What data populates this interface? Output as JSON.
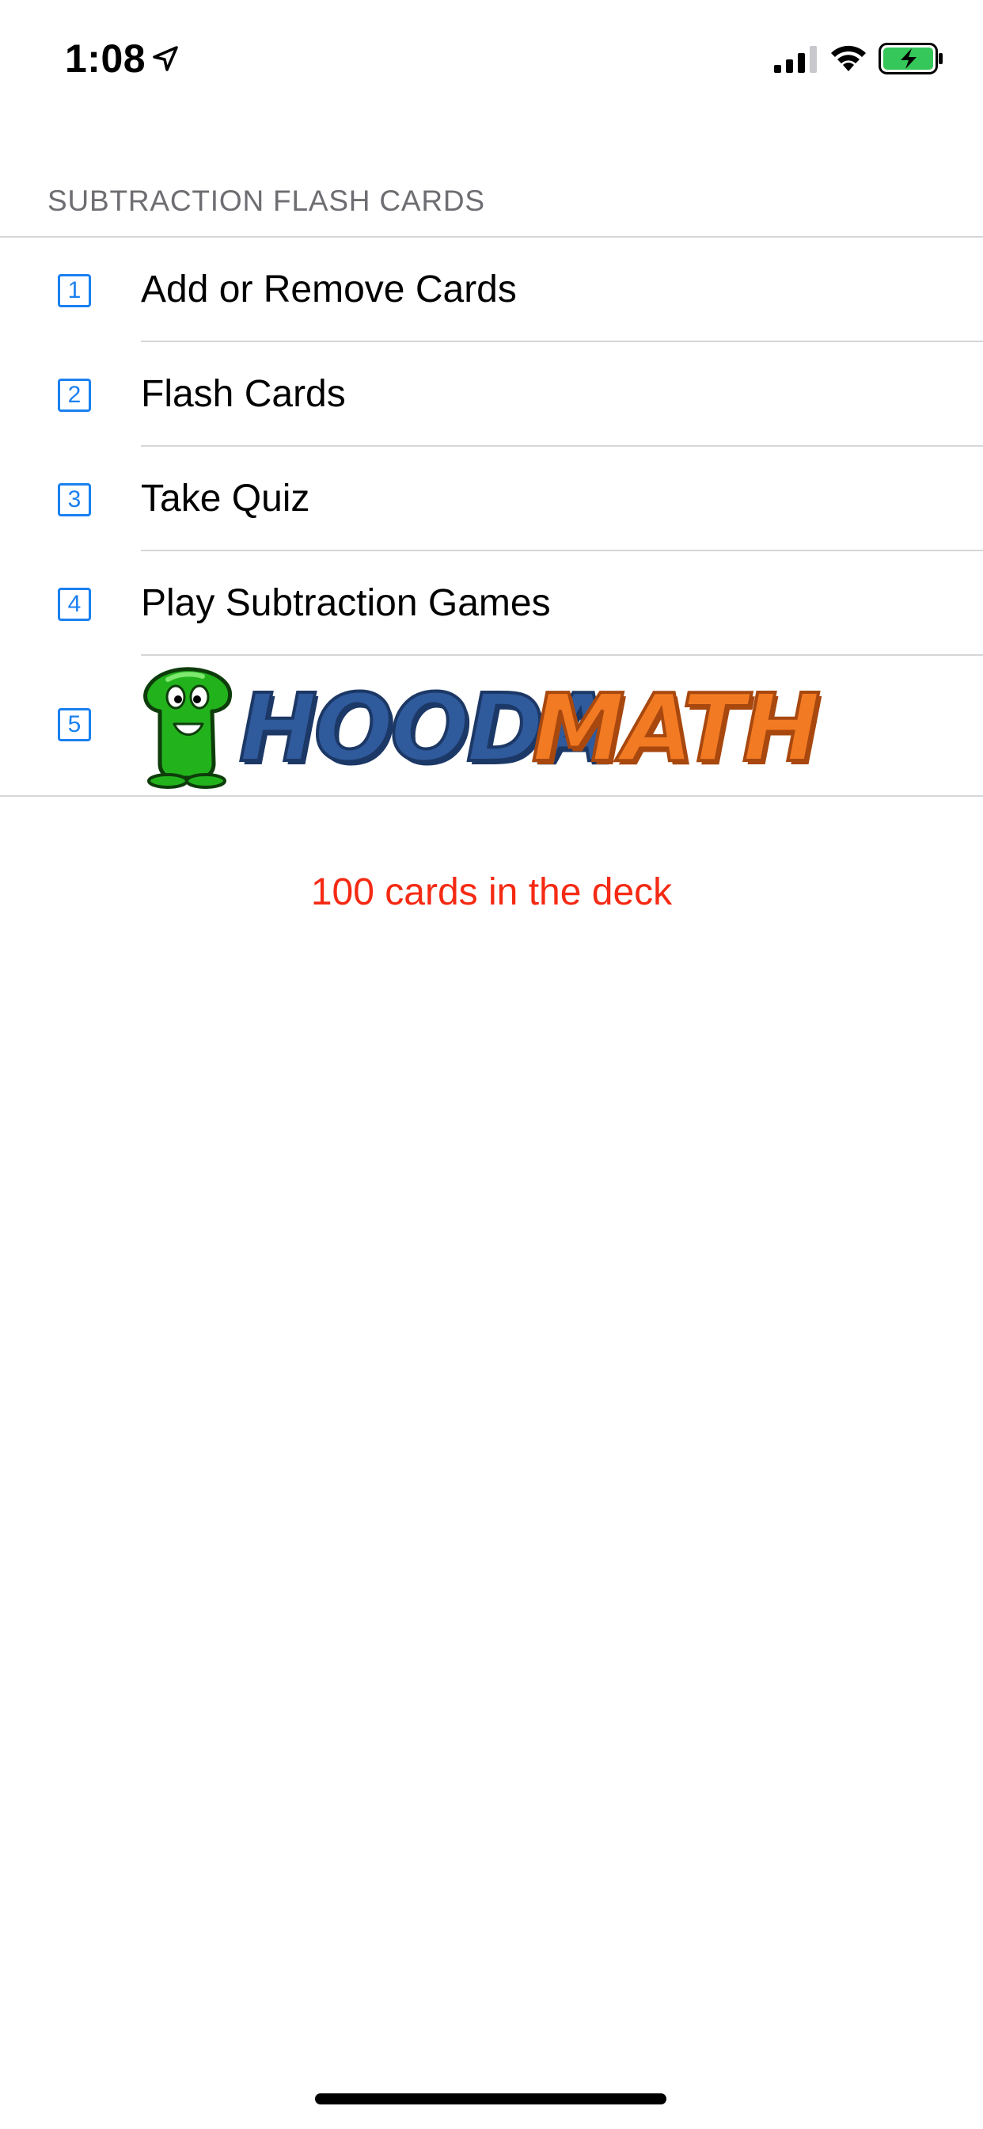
{
  "status_bar": {
    "time": "1:08"
  },
  "section": {
    "header": "SUBTRACTION FLASH CARDS"
  },
  "menu": {
    "items": [
      {
        "number": "1",
        "label": "Add or Remove Cards"
      },
      {
        "number": "2",
        "label": "Flash Cards"
      },
      {
        "number": "3",
        "label": "Take Quiz"
      },
      {
        "number": "4",
        "label": "Play Subtraction Games"
      },
      {
        "number": "5",
        "logo_text_1": "HOODA",
        "logo_text_2": "MATH"
      }
    ]
  },
  "deck": {
    "status": "100 cards in the deck"
  },
  "colors": {
    "accent": "#1a80f0",
    "status_text": "#f52a14",
    "logo_blue": "#2f5a9c",
    "logo_orange": "#f27a22",
    "mascot_green": "#22b31c",
    "battery_green": "#35c759"
  },
  "icons": {
    "location": "location-arrow-icon",
    "signal": "cellular-signal-icon",
    "wifi": "wifi-icon",
    "battery": "battery-charging-icon",
    "mascot": "hooda-mascot-icon"
  }
}
